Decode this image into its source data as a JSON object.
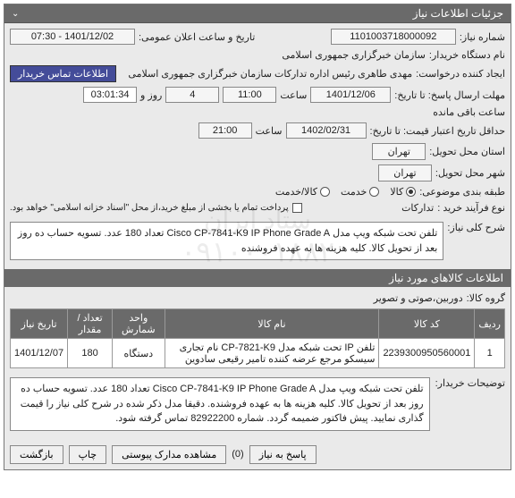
{
  "panel": {
    "title": "جزئیات اطلاعات نیاز",
    "chev": "⌄"
  },
  "fields": {
    "need_no_lbl": "شماره نیاز:",
    "need_no": "1101003718000092",
    "announce_lbl": "تاریخ و ساعت اعلان عمومی:",
    "announce": "1401/12/02 - 07:30",
    "buyer_lbl": "نام دستگاه خریدار:",
    "buyer": "سازمان خبرگزاری جمهوری اسلامی",
    "creator_lbl": "ایجاد کننده درخواست:",
    "creator": "مهدی طاهری رئیس اداره تدارکات سازمان خبرگزاری جمهوری اسلامی",
    "contact_btn": "اطلاعات تماس خریدار",
    "deadline_lbl": "مهلت ارسال پاسخ: تا تاریخ:",
    "deadline_date": "1401/12/06",
    "time_lbl": "ساعت",
    "deadline_time": "11:00",
    "days_lbl": "روز و",
    "days": "4",
    "countdown": "03:01:34",
    "remain_lbl": "ساعت باقی مانده",
    "validity_lbl": "حداقل تاریخ اعتبار قیمت: تا تاریخ:",
    "validity_date": "1402/02/31",
    "validity_time": "21:00",
    "province_lbl": "استان محل تحویل:",
    "province": "تهران",
    "city_lbl": "شهر محل تحویل:",
    "city": "تهران",
    "supply_type_lbl": "طبقه بندی موضوعی:",
    "radio_goods": "کالا",
    "radio_service": "خدمت",
    "radio_both": "کالا/خدمت",
    "buy_type_lbl": "نوع فرآیند خرید :",
    "buy_type": "تدارکات",
    "pay_note": "پرداخت تمام یا بخشی از مبلغ خرید،از محل \"اسناد خزانه اسلامی\" خواهد بود.",
    "need_desc_lbl": "شرح کلی نیاز:",
    "need_desc": "تلفن تحت شبکه ویپ مدل Cisco CP-7841-K9 IP Phone Grade A تعداد 180 عدد. تسویه حساب ده روز بعد از تحویل کالا. کلیه هزینه ها به عهده فروشنده",
    "items_title": "اطلاعات کالاهای مورد نیاز",
    "group_lbl": "گروه کالا:",
    "group": "دوربین،صوتی و تصویر",
    "buyer_notes_lbl": "توضیحات خریدار:",
    "buyer_notes": "تلفن تحت شبکه ویپ مدل Cisco CP-7841-K9 IP Phone Grade A تعداد 180 عدد. تسویه حساب ده روز بعد از تحویل کالا. کلیه هزینه ها به عهده فروشنده. دقیقا مدل ذکر شده در شرح کلی نیاز را قیمت گذاری نمایید. پیش فاکتور ضمیمه گردد. شماره 82922200 تماس گرفته شود."
  },
  "table": {
    "headers": [
      "ردیف",
      "کد کالا",
      "نام کالا",
      "واحد شمارش",
      "تعداد / مقدار",
      "تاریخ نیاز"
    ],
    "row": {
      "idx": "1",
      "code": "2239300950560001",
      "name": "تلفن IP تحت شبکه مدل CP-7821-K9 نام تجاری سیسکو مرجع عرضه کننده تامیر رقیعی سادوین",
      "unit": "دستگاه",
      "qty": "180",
      "date": "1401/12/07"
    }
  },
  "buttons": {
    "reply": "پاسخ به نیاز",
    "view_attach": "مشاهده مدارک پیوستی",
    "attach_count": "(0)",
    "print": "چاپ",
    "back": "بازگشت"
  },
  "watermark": {
    "l1": "ستاد ایران",
    "l2": "۰۹۱۰۰۰۱۸۸۲"
  }
}
